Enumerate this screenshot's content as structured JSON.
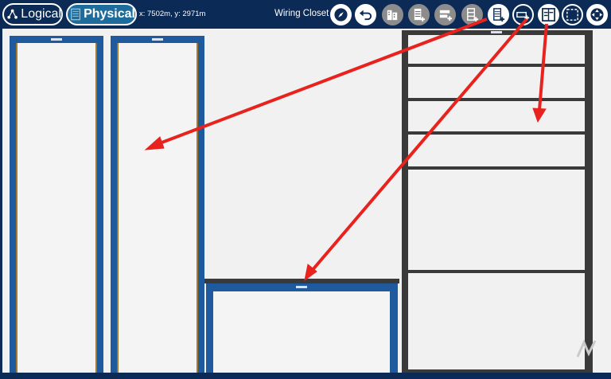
{
  "toolbar": {
    "logical_label": "Logical",
    "physical_label": "Physical",
    "coordinates": "x: 7502m, y: 2971m",
    "location": "Wiring Closet"
  },
  "icons": {
    "navigate": "compass-icon",
    "back": "undo-arrow-icon",
    "cluster": "building-icon",
    "new_rack": "rack-add-icon",
    "new_device": "device-add-icon",
    "new_shelf": "shelf-add-icon",
    "new_rack_2": "rack-add-icon",
    "new_table": "table-add-icon",
    "new_wiring_closet": "closet-icon",
    "select_area": "marquee-select-icon",
    "move_view": "pan-icon"
  },
  "colors": {
    "toolbar_bg": "#0b2a55",
    "physical_active": "#1e6c9b",
    "rack_blue": "#1f5a9e",
    "shelf_dark": "#3a3a3a",
    "workspace_bg": "#f1f1f1",
    "annotation_arrow": "#e8231e"
  }
}
